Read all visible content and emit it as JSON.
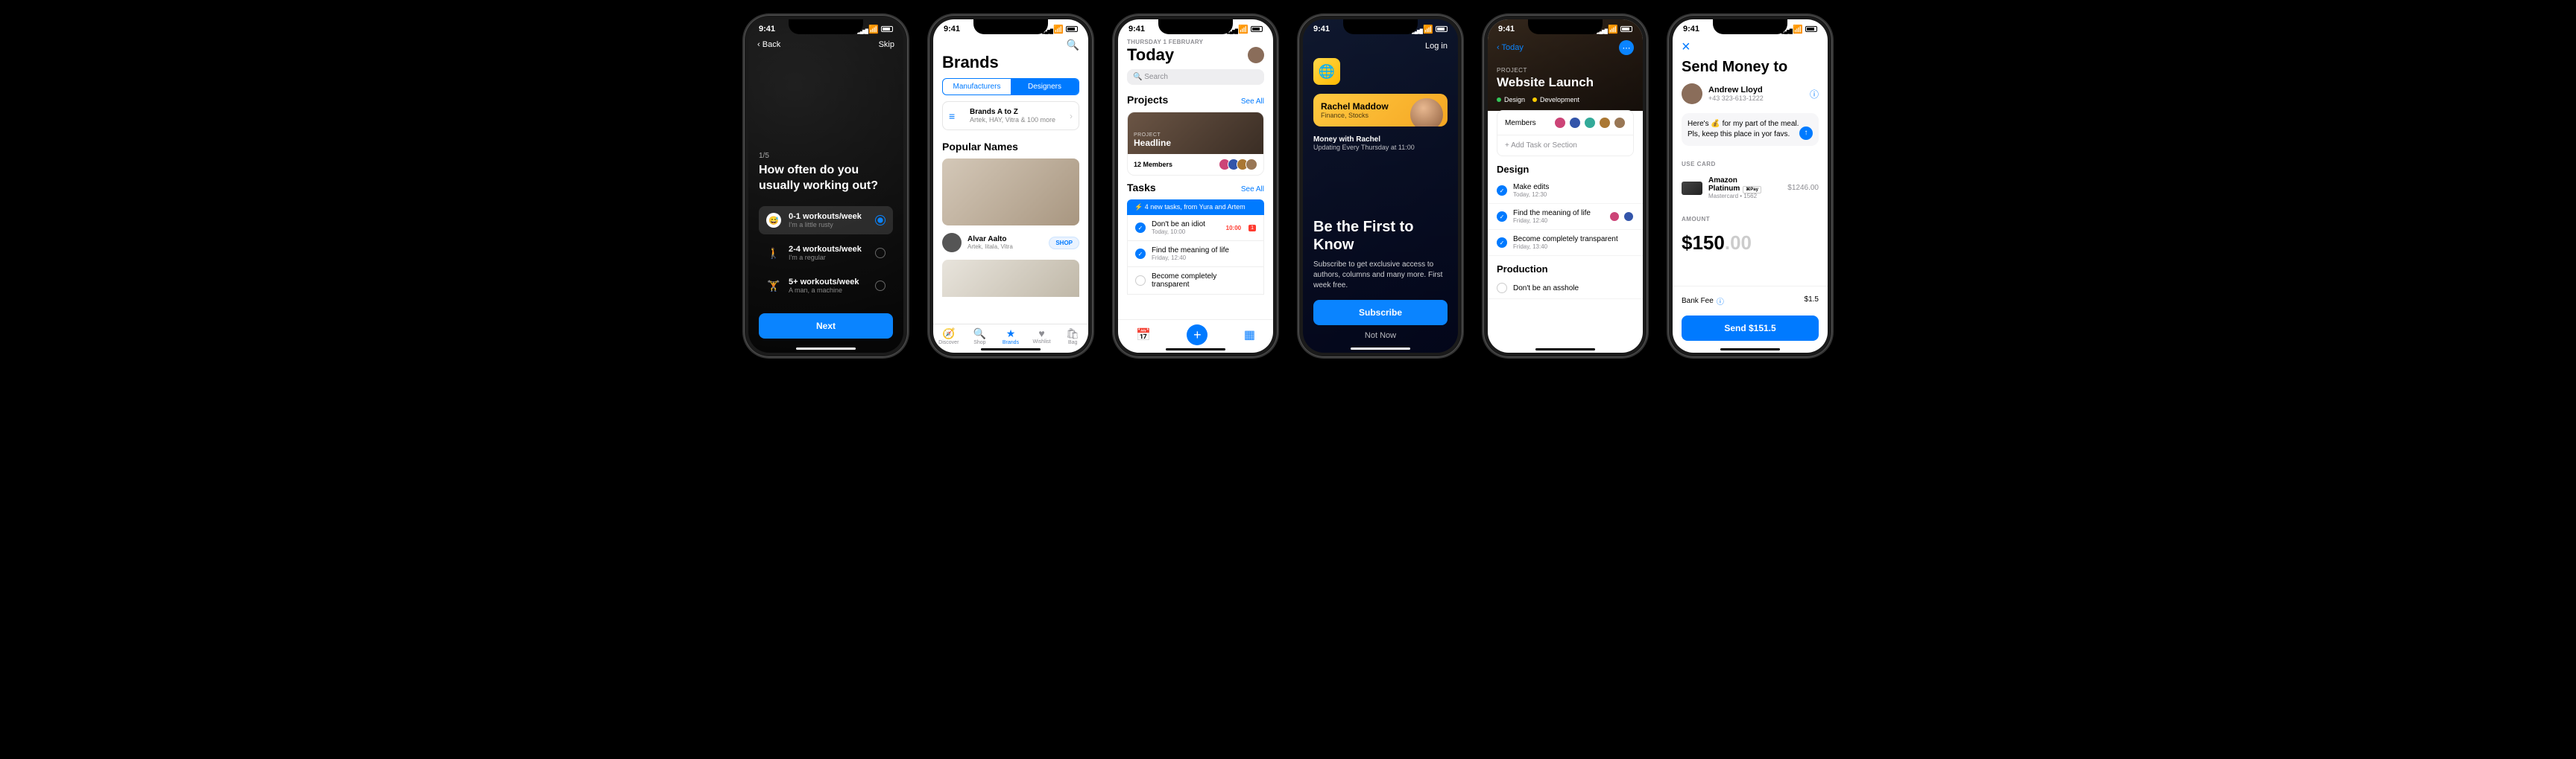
{
  "status_time": "9:41",
  "p1": {
    "back": "Back",
    "skip": "Skip",
    "step": "1/5",
    "question": "How often do you usually working out?",
    "options": [
      {
        "title": "0-1 workouts/week",
        "sub": "I'm a little rusty"
      },
      {
        "title": "2-4 workouts/week",
        "sub": "I'm a regular"
      },
      {
        "title": "5+ workouts/week",
        "sub": "A man, a machine"
      }
    ],
    "next": "Next"
  },
  "p2": {
    "title": "Brands",
    "seg": [
      "Manufacturers",
      "Designers"
    ],
    "az_title": "Brands A to Z",
    "az_sub": "Artek, HAY, Vitra & 100 more",
    "popular": "Popular Names",
    "brand_name": "Alvar Aalto",
    "brand_sub": "Artek, Iitala, Vitra",
    "shop": "SHOP",
    "tabs": [
      "Discover",
      "Shop",
      "Brands",
      "Wishlist",
      "Bag"
    ]
  },
  "p3": {
    "date": "THURSDAY 1 FEBRUARY",
    "title": "Today",
    "search": "Search",
    "projects": "Projects",
    "see_all": "See All",
    "proj_label": "PROJECT",
    "proj_title": "Headline",
    "members": "12 Members",
    "tasks": "Tasks",
    "banner": "⚡ 4 new tasks, from Yura and Artem",
    "task_list": [
      {
        "title": "Don't be an idiot",
        "sub": "Today, 10:00",
        "due": "10:00",
        "badge": "1"
      },
      {
        "title": "Find the meaning of life",
        "sub": "Friday, 12:40"
      },
      {
        "title": "Become completely transparent",
        "sub": ""
      }
    ]
  },
  "p4": {
    "login": "Log in",
    "feature_name": "Rachel Maddow",
    "feature_sub": "Finance, Stocks",
    "show_title": "Money with Rachel",
    "show_sub": "Updating Every Thursday at 11:00",
    "headline": "Be the First to Know",
    "desc": "Subscribe to get exclusive access to authors, columns and many more. First week free.",
    "subscribe": "Subscribe",
    "notnow": "Not Now"
  },
  "p5": {
    "back": "Today",
    "proj_label": "PROJECT",
    "proj_name": "Website Launch",
    "tags": [
      "Design",
      "Development"
    ],
    "members": "Members",
    "add_task": "+   Add Task or Section",
    "sections": {
      "design": "Design",
      "production": "Production"
    },
    "design_tasks": [
      {
        "title": "Make edits",
        "sub": "Today, 12:30"
      },
      {
        "title": "Find the meaning of life",
        "sub": "Friday, 12:40"
      },
      {
        "title": "Become completely transparent",
        "sub": "Friday, 13:40"
      }
    ],
    "prod_tasks": [
      {
        "title": "Don't be an asshole",
        "sub": ""
      }
    ]
  },
  "p6": {
    "title": "Send Money to",
    "recip_name": "Andrew Lloyd",
    "recip_phone": "+43 323-613-1222",
    "note": "Here's 💰 for my part of the meal. Pls, keep this place in yor favs.",
    "use_card": "USE CARD",
    "card_name": "Amazon Platinum",
    "card_sub": "Mastercard • 1562",
    "apay": "⌘Pay",
    "card_amt": "$1246.00",
    "amount_lbl": "AMOUNT",
    "amount_main": "$150",
    "amount_dec": ".00",
    "fee_lbl": "Bank Fee",
    "fee_amt": "$1.5",
    "send": "Send $151.5"
  }
}
